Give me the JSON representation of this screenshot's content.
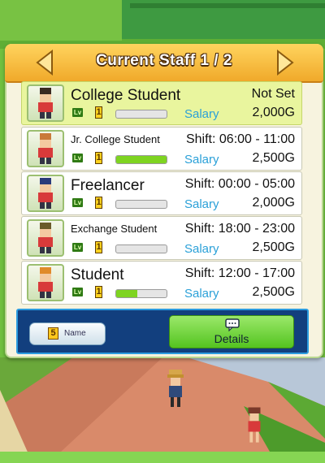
{
  "header": {
    "title": "Current Staff 1 / 2"
  },
  "colors": {
    "accent": "#f0a92a",
    "selected_row": "#e9f59e",
    "salary_label": "#2aa0d8",
    "details_button": "#54c420",
    "panel_border": "#2b9be0"
  },
  "staff": [
    {
      "name": "College Student",
      "shift": "Not Set",
      "level": "1",
      "salary_label": "Salary",
      "salary": "2,000G",
      "xp": 0.0,
      "selected": true
    },
    {
      "name": "Jr. College Student",
      "shift": "Shift: 06:00 - 11:00",
      "level": "1",
      "salary_label": "Salary",
      "salary": "2,500G",
      "xp": 1.0,
      "selected": false
    },
    {
      "name": "Freelancer",
      "shift": "Shift: 00:00 - 05:00",
      "level": "1",
      "salary_label": "Salary",
      "salary": "2,000G",
      "xp": 0.0,
      "selected": false
    },
    {
      "name": "Exchange Student",
      "shift": "Shift: 18:00 - 23:00",
      "level": "1",
      "salary_label": "Salary",
      "salary": "2,500G",
      "xp": 0.0,
      "selected": false
    },
    {
      "name": "Student",
      "shift": "Shift: 12:00 - 17:00",
      "level": "1",
      "salary_label": "Salary",
      "salary": "2,500G",
      "xp": 0.42,
      "selected": false
    }
  ],
  "level_badge": "Lv",
  "sort": {
    "badge": "5",
    "label": "Name"
  },
  "details": {
    "label": "Details"
  }
}
